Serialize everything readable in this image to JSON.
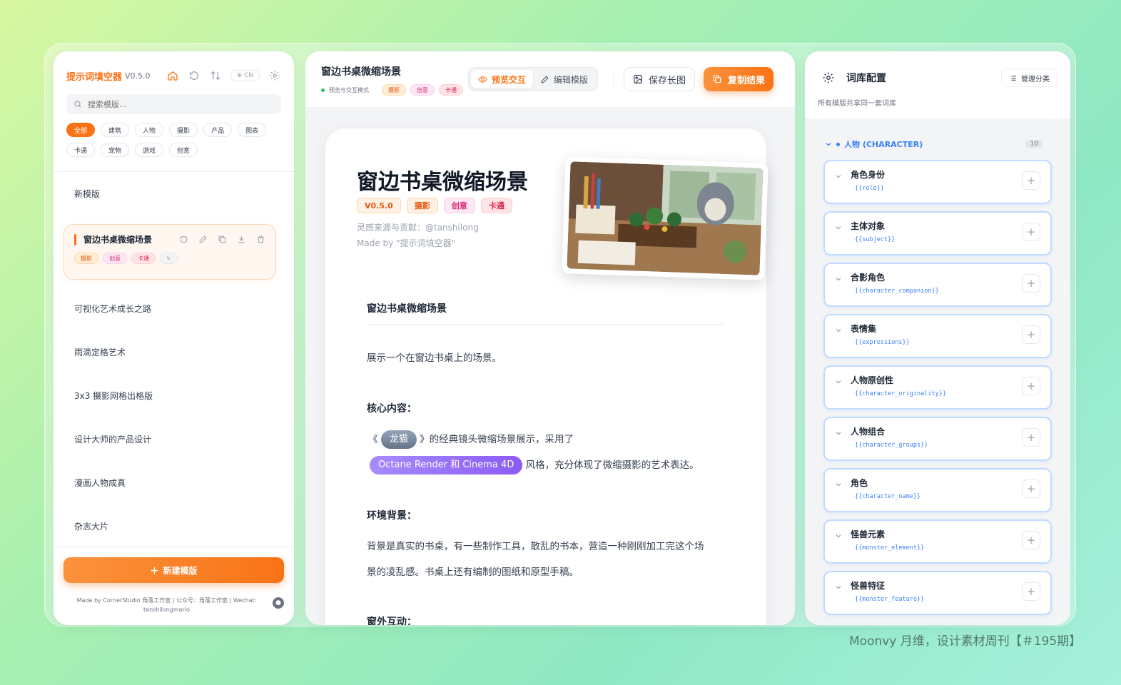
{
  "left": {
    "brand": "提示词填空器",
    "version": "V0.5.0",
    "lang": "CN",
    "search_placeholder": "搜索模版...",
    "filters": [
      {
        "label": "全部",
        "active": true
      },
      {
        "label": "建筑"
      },
      {
        "label": "人物"
      },
      {
        "label": "摄影"
      },
      {
        "label": "产品"
      },
      {
        "label": "图表"
      },
      {
        "label": "卡通"
      },
      {
        "label": "宠物"
      },
      {
        "label": "游戏"
      },
      {
        "label": "创意"
      }
    ],
    "templates_before": [
      "新模版"
    ],
    "active_template": {
      "title": "窗边书桌微缩场景",
      "tags": [
        "摄影",
        "创意",
        "卡通"
      ],
      "edit_tag": "✎"
    },
    "templates_after": [
      "可视化艺术成长之路",
      "雨滴定格艺术",
      "3x3 摄影网格出格版",
      "设计大师的产品设计",
      "漫画人物成真",
      "杂志大片"
    ],
    "new_button": "新建模版",
    "credit_line1": "Made by CornerStudio 角落工作室 | 公众号：角落工作室 | Wechat:",
    "credit_line2": "tanshilongmario"
  },
  "center": {
    "title": "窗边书桌微缩场景",
    "mode": "预览与交互模式",
    "tags": [
      "摄影",
      "创意",
      "卡通"
    ],
    "preview_label": "预览交互",
    "edit_label": "编辑模版",
    "save_label": "保存长图",
    "copy_label": "复制结果",
    "doc": {
      "title": "窗边书桌微缩场景",
      "version_tag": "V0.5.0",
      "tags": [
        "摄影",
        "创意",
        "卡通"
      ],
      "credit1": "灵感来源与贡献：@tanshilong",
      "credit2": "Made by \"提示词填空器\"",
      "h1": "窗边书桌微缩场景",
      "intro": "展示一个在窗边书桌上的场景。",
      "h2": "核心内容：",
      "core_pre": "《",
      "core_var1": "龙猫",
      "core_mid": "》的经典镜头微缩场景展示，采用了",
      "core_var2": "Octane Render 和 Cinema 4D",
      "core_post": "风格，充分体现了微缩摄影的艺术表达。",
      "h3": "环境背景：",
      "env1": "背景是真实的书桌，有一些制作工具，散乱的书本，营造一种刚刚加工完这个场",
      "env2": "景的凌乱感。书桌上还有编制的图纸和原型手稿。",
      "h4": "窗外互动："
    }
  },
  "right": {
    "title": "词库配置",
    "manage_label": "管理分类",
    "subtitle": "所有模版共享同一套词库",
    "category": "人物 (CHARACTER)",
    "count": "10",
    "variables": [
      {
        "name": "角色身份",
        "key": "{{role}}"
      },
      {
        "name": "主体对象",
        "key": "{{subject}}"
      },
      {
        "name": "合影角色",
        "key": "{{character_companion}}"
      },
      {
        "name": "表情集",
        "key": "{{expressions}}"
      },
      {
        "name": "人物原创性",
        "key": "{{character_originality}}"
      },
      {
        "name": "人物组合",
        "key": "{{character_groups}}"
      },
      {
        "name": "角色",
        "key": "{{character_name}}"
      },
      {
        "name": "怪兽元素",
        "key": "{{monster_element}}"
      },
      {
        "name": "怪兽特征",
        "key": "{{monster_feature}}"
      }
    ]
  },
  "watermark": "Moonvy 月维，设计素材周刊【＃195期】",
  "colors": {
    "accent": "#f97316",
    "blue": "#3b82f6",
    "purple": "#8b5cf6"
  }
}
